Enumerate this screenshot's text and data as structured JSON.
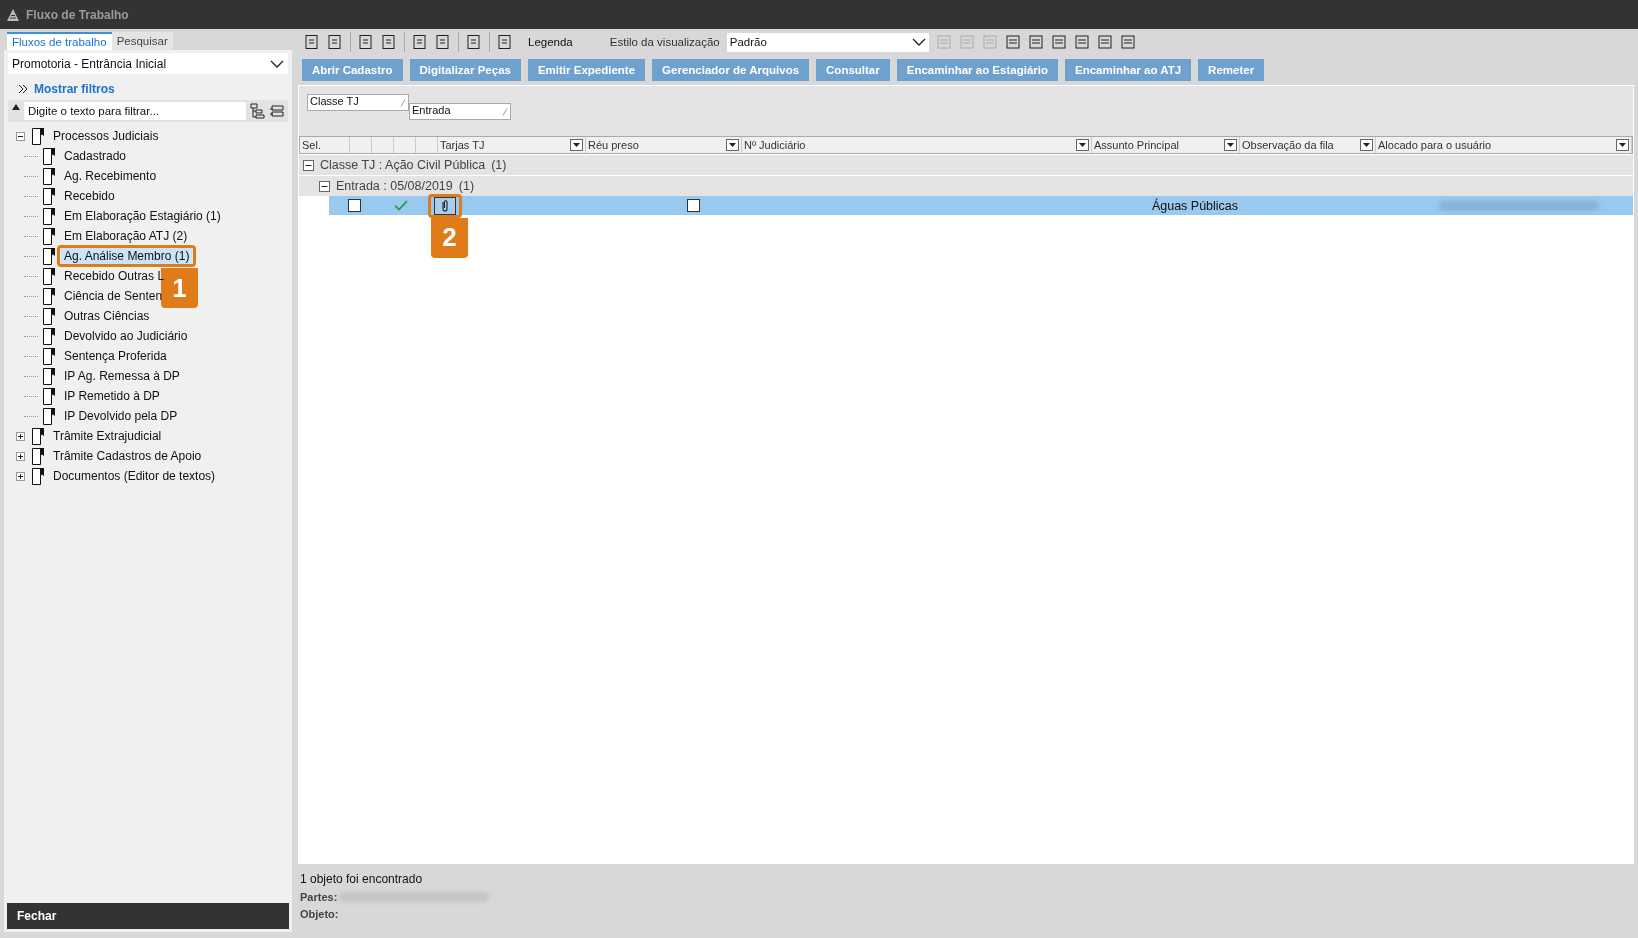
{
  "window": {
    "title": "Fluxo de Trabalho"
  },
  "left_tabs": [
    {
      "label": "Fluxos de trabalho",
      "selected": true
    },
    {
      "label": "Pesquisar",
      "selected": false
    }
  ],
  "workflow_select": {
    "value": "Promotoria - Entrância Inicial"
  },
  "show_filters": "Mostrar filtros",
  "filter": {
    "placeholder": "Digite o texto para filtrar..."
  },
  "tree": [
    {
      "label": "Processos Judiciais",
      "expanded": true,
      "selected": false,
      "children": [
        {
          "label": "Cadastrado",
          "selected": false
        },
        {
          "label": "Ag. Recebimento",
          "selected": false
        },
        {
          "label": "Recebido",
          "selected": false
        },
        {
          "label": "Em Elaboração Estagiário (1)",
          "selected": false
        },
        {
          "label": "Em Elaboração ATJ (2)",
          "selected": false
        },
        {
          "label": "Ag. Análise Membro (1)",
          "selected": true,
          "callout": "1"
        },
        {
          "label": "Recebido Outras L",
          "selected": false
        },
        {
          "label": "Ciência de Senten",
          "selected": false
        },
        {
          "label": "Outras Ciências",
          "selected": false
        },
        {
          "label": "Devolvido ao Judiciário",
          "selected": false
        },
        {
          "label": "Sentença Proferida",
          "selected": false
        },
        {
          "label": "IP Ag. Remessa à DP",
          "selected": false
        },
        {
          "label": "IP Remetido à DP",
          "selected": false
        },
        {
          "label": "IP Devolvido pela DP",
          "selected": false
        }
      ]
    },
    {
      "label": "Trâmite Extrajudicial",
      "expanded": false,
      "selected": false
    },
    {
      "label": "Trâmite Cadastros de Apoio",
      "expanded": false,
      "selected": false
    },
    {
      "label": "Documentos (Editor de textos)",
      "expanded": false,
      "selected": false
    }
  ],
  "close_button": "Fechar",
  "toolbar": {
    "legend": "Legenda",
    "view_style_label": "Estilo da visualização",
    "view_style": "Padrão"
  },
  "actions": [
    "Abrir Cadastro",
    "Digitalizar Peças",
    "Emitir Expediente",
    "Gerenciador de Arquivos",
    "Consultar",
    "Encaminhar ao Estagiário",
    "Encaminhar ao ATJ",
    "Remeter"
  ],
  "group_by": [
    "Classe TJ",
    "Entrada"
  ],
  "columns": [
    {
      "label": "Sel.",
      "filter": false
    },
    {
      "filter": false
    },
    {
      "filter": false
    },
    {
      "filter": false
    },
    {
      "filter": false
    },
    {
      "label": "Tarjas TJ",
      "filter": true
    },
    {
      "label": "Réu preso",
      "filter": true
    },
    {
      "label": "Nº Judiciário",
      "filter": true
    },
    {
      "label": "Assunto Principal",
      "filter": true
    },
    {
      "label": "Observação da fila",
      "filter": true
    },
    {
      "label": "Alocado para o usuário",
      "filter": true
    }
  ],
  "groups": [
    {
      "label": "Classe TJ : Ação Civil Pública",
      "count": "(1)",
      "expanded": true,
      "children": [
        {
          "label": "Entrada : 05/08/2019",
          "count": "(1)",
          "expanded": true
        }
      ]
    }
  ],
  "rows": [
    {
      "selected": true,
      "checked": false,
      "done": true,
      "attachment": true,
      "attachment_callout": "2",
      "reu_preso": false,
      "assunto": "Águas Públicas"
    }
  ],
  "status": {
    "found": "1 objeto foi encontrado",
    "partes_label": "Partes:",
    "objeto_label": "Objeto:"
  }
}
